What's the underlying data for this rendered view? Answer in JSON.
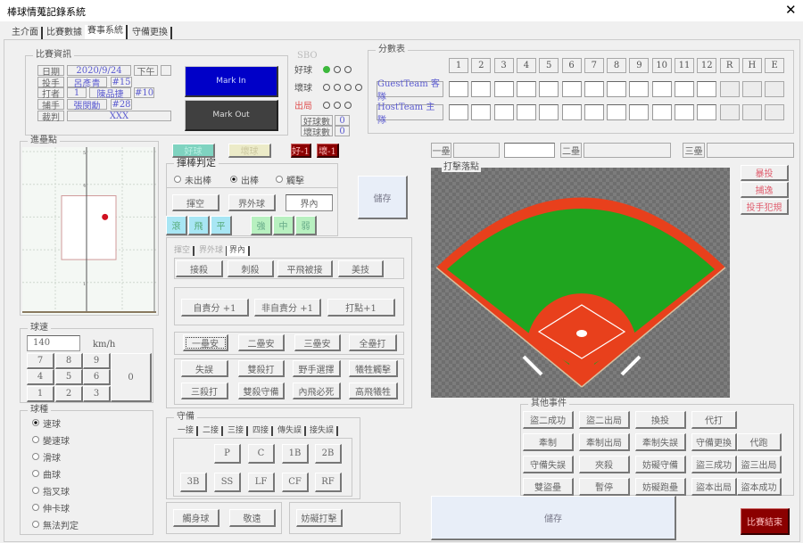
{
  "window": {
    "title": "棒球情蒐記錄系統",
    "close": "✕"
  },
  "tabs": [
    "主介面",
    "比賽數據",
    "賽事系統",
    "守備更換"
  ],
  "game_info": {
    "title": "比賽資訊",
    "date_label": "日期",
    "date": "2020/9/24",
    "half": "下午",
    "half_extra": "",
    "pitcher_label": "投手",
    "pitcher": "呂彥青",
    "pitcher_no": "#15",
    "batter_label": "打者",
    "batter_order": "1",
    "batter": "陳品捷",
    "batter_no": "#10",
    "catcher_label": "捕手",
    "catcher": "張閔勳",
    "catcher_no": "#28",
    "umpire_label": "裁判",
    "umpire": "XXX"
  },
  "mark": {
    "in": "Mark In",
    "out": "Mark Out"
  },
  "sbo": {
    "title": "SBO",
    "ball_label": "好球",
    "strike_label": "壞球",
    "out_label": "出局",
    "balls_lit": 1,
    "ball_count_label": "好球數",
    "ball_count": "0",
    "strike_count_label": "壞球數",
    "strike_count": "0"
  },
  "scoreboard": {
    "title": "分數表",
    "headers": [
      "1",
      "2",
      "3",
      "4",
      "5",
      "6",
      "7",
      "8",
      "9",
      "10",
      "11",
      "12",
      "R",
      "H",
      "E"
    ],
    "guest": "GuestTeam 客隊",
    "host": "HostTeam 主隊"
  },
  "quick": {
    "ball": "好球",
    "strike": "壞球",
    "ball_minus": "好-1",
    "strike_minus": "壞-1"
  },
  "pitch_location": {
    "title": "進壘點",
    "ticks": [
      "1",
      "2",
      "3",
      "4",
      "5"
    ],
    "point": {
      "x": 0.45,
      "y": 3.0
    }
  },
  "speed": {
    "title": "球速",
    "value": "140",
    "unit": "km/h",
    "keys": [
      "7",
      "8",
      "9",
      "4",
      "5",
      "6",
      "1",
      "2",
      "3",
      "0"
    ]
  },
  "pitch_type": {
    "title": "球種",
    "options": [
      "速球",
      "變速球",
      "滑球",
      "曲球",
      "指叉球",
      "伸卡球",
      "無法判定"
    ],
    "selected": 0
  },
  "swing": {
    "title": "揮棒判定",
    "options": [
      "未出棒",
      "出棒",
      "觸擊"
    ],
    "selected": 1,
    "buttons": [
      "揮空",
      "界外球",
      "界內"
    ]
  },
  "save": "儲存",
  "trajectory": [
    "滾",
    "飛",
    "平"
  ],
  "strength": [
    "強",
    "中",
    "弱"
  ],
  "result_tabs": [
    "揮空",
    "界外球",
    "界內"
  ],
  "results": {
    "row1": [
      "接殺",
      "刺殺",
      "平飛被接",
      "美技"
    ],
    "row2": [
      "自責分 +1",
      "非自責分 +1",
      "打點+1"
    ],
    "row3": [
      "一壘安",
      "二壘安",
      "三壘安",
      "全壘打"
    ],
    "row4": [
      "失誤",
      "雙殺打",
      "野手選擇",
      "犧牲觸擊",
      "三殺打",
      "雙殺守備",
      "內飛必死",
      "高飛犧牲"
    ]
  },
  "defense": {
    "title": "守備",
    "tabs": [
      "一接",
      "二接",
      "三接",
      "四接",
      "傳失誤",
      "接失誤"
    ],
    "positions": [
      "P",
      "C",
      "1B",
      "2B",
      "3B",
      "SS",
      "LF",
      "CF",
      "RF"
    ]
  },
  "misc": [
    "觸身球",
    "敬遠",
    "妨礙打擊"
  ],
  "bases": {
    "first": "一壘",
    "second": "二壘",
    "third": "三壘"
  },
  "hit_location": {
    "title": "打擊落點"
  },
  "pitch_events": [
    "暴投",
    "捕逸",
    "投手犯規"
  ],
  "other_events": {
    "title": "其他事件",
    "buttons": [
      "盜二成功",
      "盜二出局",
      "換投",
      "代打",
      "牽制",
      "牽制出局",
      "牽制失誤",
      "守備更換",
      "代跑",
      "守備失誤",
      "夾殺",
      "妨礙守備",
      "盜三成功",
      "盜三出局",
      "雙盜壘",
      "暫停",
      "妨礙跑壘",
      "盜本出局",
      "盜本成功"
    ]
  },
  "bottom": {
    "save": "儲存",
    "end": "比賽結束"
  },
  "colors": {
    "mark_in": "#0000c8",
    "mark_out": "#404040",
    "dark_red": "#8b0000",
    "grass": "#1fa51f",
    "dirt": "#e8401c"
  }
}
